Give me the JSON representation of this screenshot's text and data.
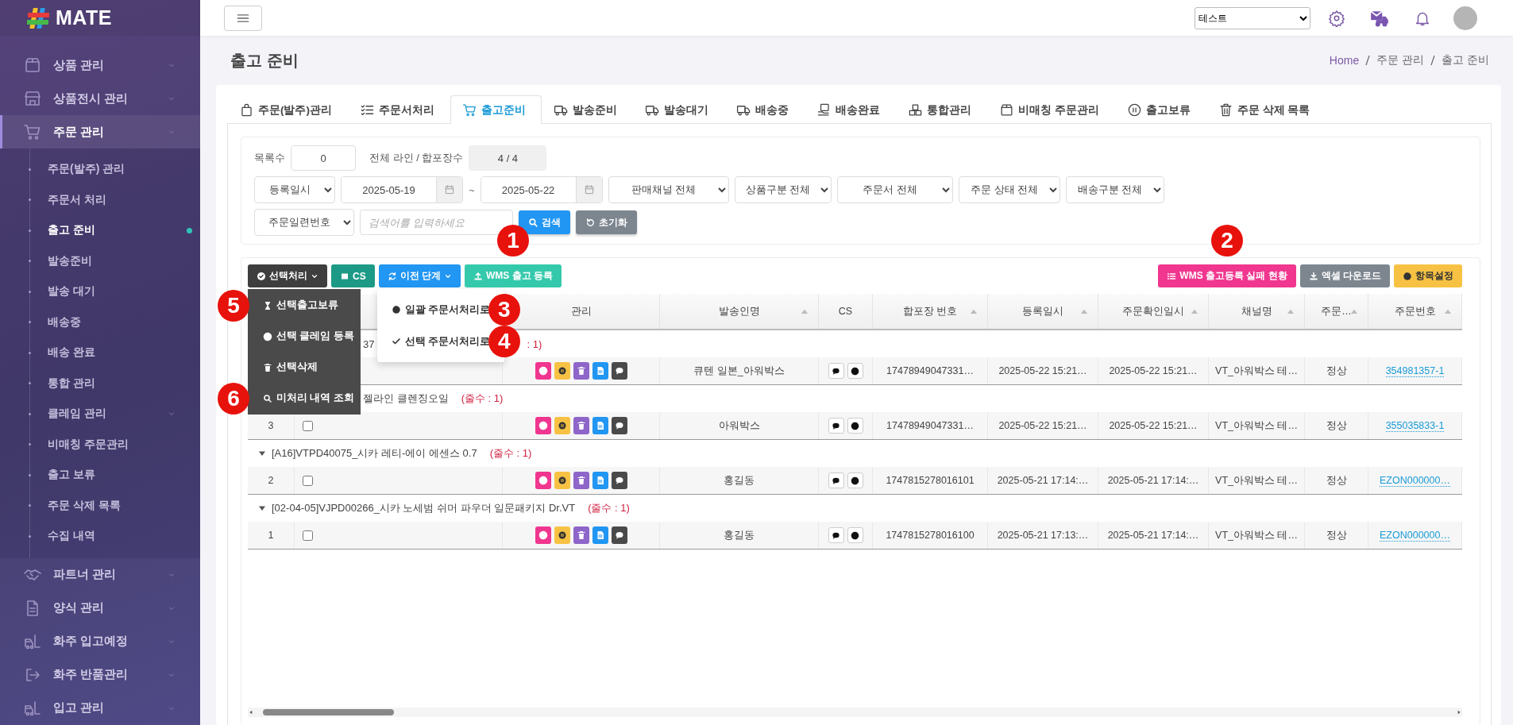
{
  "brand": {
    "name": "MATE"
  },
  "sidebar": {
    "items": [
      {
        "label": "상품 관리",
        "selected": false,
        "expandable": true,
        "expanded": false
      },
      {
        "label": "상품전시 관리",
        "selected": false,
        "expandable": true,
        "expanded": false
      },
      {
        "label": "주문 관리",
        "selected": true,
        "expandable": true,
        "expanded": true,
        "children": [
          {
            "label": "주문(발주) 관리",
            "selected": false,
            "expandable": false
          },
          {
            "label": "주문서 처리",
            "selected": false,
            "expandable": false
          },
          {
            "label": "출고 준비",
            "selected": true,
            "expandable": false
          },
          {
            "label": "발송준비",
            "selected": false,
            "expandable": false
          },
          {
            "label": "발송 대기",
            "selected": false,
            "expandable": false
          },
          {
            "label": "배송중",
            "selected": false,
            "expandable": false
          },
          {
            "label": "배송 완료",
            "selected": false,
            "expandable": false
          },
          {
            "label": "통합 관리",
            "selected": false,
            "expandable": false
          },
          {
            "label": "클레임 관리",
            "selected": false,
            "expandable": true
          },
          {
            "label": "비매칭 주문관리",
            "selected": false,
            "expandable": false
          },
          {
            "label": "출고 보류",
            "selected": false,
            "expandable": false
          },
          {
            "label": "주문 삭제 목록",
            "selected": false,
            "expandable": false
          },
          {
            "label": "수집 내역",
            "selected": false,
            "expandable": false
          }
        ]
      },
      {
        "label": "파트너 관리",
        "selected": false,
        "expandable": true,
        "expanded": false
      },
      {
        "label": "양식 관리",
        "selected": false,
        "expandable": true,
        "expanded": false
      },
      {
        "label": "화주 입고예정",
        "selected": false,
        "expandable": true,
        "expanded": false
      },
      {
        "label": "화주 반품관리",
        "selected": false,
        "expandable": true,
        "expanded": false
      },
      {
        "label": "입고 관리",
        "selected": false,
        "expandable": true,
        "expanded": false
      }
    ]
  },
  "topbar": {
    "company_select": "테스트"
  },
  "page": {
    "title": "출고 준비",
    "breadcrumb": [
      "Home",
      "주문 관리",
      "출고 준비"
    ]
  },
  "tabs": [
    {
      "label": "주문(발주)관리",
      "selected": false
    },
    {
      "label": "주문서처리",
      "selected": false
    },
    {
      "label": "출고준비",
      "selected": true
    },
    {
      "label": "발송준비",
      "selected": false
    },
    {
      "label": "발송대기",
      "selected": false
    },
    {
      "label": "배송중",
      "selected": false
    },
    {
      "label": "배송완료",
      "selected": false
    },
    {
      "label": "통합관리",
      "selected": false
    },
    {
      "label": "비매칭 주문관리",
      "selected": false
    },
    {
      "label": "출고보류",
      "selected": false
    },
    {
      "label": "주문 삭제 목록",
      "selected": false
    }
  ],
  "filters": {
    "list_count_label": "목록수",
    "list_count": "0",
    "total_label": "전체 라인 / 합포장수",
    "total": "4 / 4",
    "date_type": "등록일시",
    "date_from": "2025-05-19",
    "range_separator": "~",
    "date_to": "2025-05-22",
    "selects": [
      "판매채널 전체",
      "상품구분 전체",
      "주문서 전체",
      "주문 상태 전체",
      "배송구분 전체"
    ],
    "search_type": "주문일련번호",
    "search_placeholder": "검색어를 입력하세요",
    "search_button": "검색",
    "reset_button": "초기화"
  },
  "toolbar": {
    "left": [
      {
        "label": "선택처리",
        "kind": "dark",
        "menu": {
          "open": true,
          "items": [
            {
              "label": "선택출고보류",
              "marker": "5"
            },
            {
              "label": "선택 클레임 등록"
            },
            {
              "label": "선택삭제"
            },
            {
              "label": "미처리 내역 조회",
              "marker": "6"
            }
          ]
        }
      },
      {
        "label": "CS",
        "kind": "teal"
      },
      {
        "label": "이전 단계",
        "kind": "blue",
        "menu": {
          "open": true,
          "items": [
            {
              "label": "일괄 주문서처리로",
              "marker": "3"
            },
            {
              "label": "선택 주문서처리로",
              "marker": "4"
            }
          ]
        }
      },
      {
        "label": "WMS 출고 등록",
        "kind": "mint",
        "marker": "1"
      }
    ],
    "right": [
      {
        "label": "WMS 출고등록 실패 현황",
        "kind": "pink",
        "marker": "2"
      },
      {
        "label": "엑셀 다운로드",
        "kind": "gray"
      },
      {
        "label": "항목설정",
        "kind": "yellow"
      }
    ]
  },
  "table": {
    "columns": [
      {
        "label": "관리",
        "sortable": false
      },
      {
        "label": "발송인명",
        "sortable": true
      },
      {
        "label": "CS",
        "sortable": false
      },
      {
        "label": "합포장 번호",
        "sortable": true
      },
      {
        "label": "등록일시",
        "sortable": true
      },
      {
        "label": "주문확인일시",
        "sortable": true
      },
      {
        "label": "채널명",
        "sortable": true
      },
      {
        "label": "주문…",
        "sortable": true
      },
      {
        "label": "주문번호",
        "sortable": true
      }
    ],
    "groups": [
      {
        "label": "37",
        "count": ": 1)",
        "under_left_menu": true,
        "under_right_menu": true,
        "rows": [
          {
            "sender": "큐텐 일본_아워박스",
            "bundle_no": "17478949047331…",
            "registered": "2025-05-22 15:21…",
            "confirmed": "2025-05-22 15:21…",
            "channel": "VT_아워박스 테…",
            "status": "정상",
            "order_no": "354981357-1"
          }
        ]
      },
      {
        "label": "젤라인 클렌징오일",
        "count": "(줄수 : 1)",
        "under_left_menu": true,
        "under_right_menu": false,
        "rows": [
          {
            "index": "3",
            "checked": false,
            "sender": "아워박스",
            "bundle_no": "17478949047331…",
            "registered": "2025-05-22 15:21…",
            "confirmed": "2025-05-22 15:21…",
            "channel": "VT_아워박스 테…",
            "status": "정상",
            "order_no": "355035833-1"
          }
        ]
      },
      {
        "label": "[A16]VTPD40075_시카 레티-에이 에센스 0.7",
        "count": "(줄수 : 1)",
        "under_left_menu": false,
        "under_right_menu": false,
        "rows": [
          {
            "index": "2",
            "checked": false,
            "sender": "홍길동",
            "bundle_no": "1747815278016101",
            "registered": "2025-05-21 17:14:…",
            "confirmed": "2025-05-21 17:14:…",
            "channel": "VT_아워박스 테…",
            "status": "정상",
            "order_no": "EZON000000…"
          }
        ]
      },
      {
        "label": "[02-04-05]VJPD00266_시카 노세범 쉬머 파우더 일문패키지 Dr.VT",
        "count": "(줄수 : 1)",
        "under_left_menu": false,
        "under_right_menu": false,
        "rows": [
          {
            "index": "1",
            "checked": false,
            "sender": "홍길동",
            "bundle_no": "1747815278016100",
            "registered": "2025-05-21 17:13:…",
            "confirmed": "2025-05-21 17:14:…",
            "channel": "VT_아워박스 테…",
            "status": "정상",
            "order_no": "EZON000000…"
          }
        ]
      }
    ]
  }
}
